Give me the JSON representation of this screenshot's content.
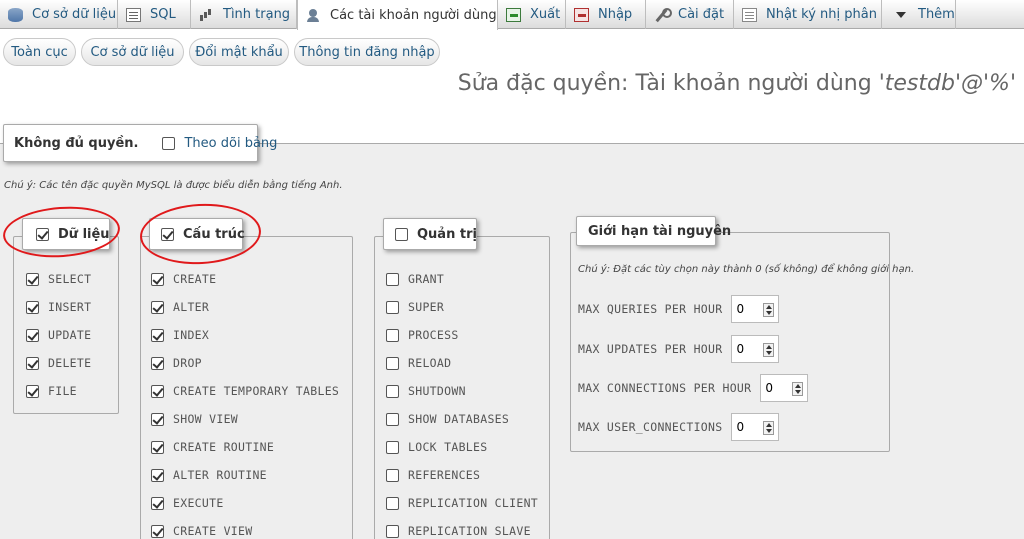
{
  "tabs": [
    {
      "label": "Cơ sở dữ liệu",
      "icon": "database-icon"
    },
    {
      "label": "SQL",
      "icon": "sql-icon"
    },
    {
      "label": "Tình trạng",
      "icon": "status-chart-icon"
    },
    {
      "label": "Các tài khoản người dùng",
      "icon": "users-icon"
    },
    {
      "label": "Xuất",
      "icon": "export-icon"
    },
    {
      "label": "Nhập",
      "icon": "import-icon"
    },
    {
      "label": "Cài đặt",
      "icon": "wrench-icon"
    },
    {
      "label": "Nhật ký nhị phân",
      "icon": "log-icon"
    },
    {
      "label": "Thêm",
      "icon": "caret-down-icon"
    }
  ],
  "subtabs": [
    "Toàn cục",
    "Cơ sở dữ liệu",
    "Đổi mật khẩu",
    "Thông tin đăng nhập"
  ],
  "page_title_prefix": "Sửa đặc quyền: Tài khoản người dùng ",
  "page_title_user": "'testdb'@'%'",
  "global_box": {
    "label": "Không đủ quyền.",
    "track_label": "Theo dõi bảng"
  },
  "note_privileges": "Chú ý: Các tên đặc quyền MySQL là được biểu diễn bằng tiếng Anh.",
  "data_group": {
    "title": "Dữ liệu",
    "checked": true,
    "items": [
      {
        "label": "SELECT",
        "checked": true
      },
      {
        "label": "INSERT",
        "checked": true
      },
      {
        "label": "UPDATE",
        "checked": true
      },
      {
        "label": "DELETE",
        "checked": true
      },
      {
        "label": "FILE",
        "checked": true
      }
    ]
  },
  "structure_group": {
    "title": "Cấu trúc",
    "checked": true,
    "items": [
      {
        "label": "CREATE",
        "checked": true
      },
      {
        "label": "ALTER",
        "checked": true
      },
      {
        "label": "INDEX",
        "checked": true
      },
      {
        "label": "DROP",
        "checked": true
      },
      {
        "label": "CREATE TEMPORARY TABLES",
        "checked": true
      },
      {
        "label": "SHOW VIEW",
        "checked": true
      },
      {
        "label": "CREATE ROUTINE",
        "checked": true
      },
      {
        "label": "ALTER ROUTINE",
        "checked": true
      },
      {
        "label": "EXECUTE",
        "checked": true
      },
      {
        "label": "CREATE VIEW",
        "checked": true
      }
    ]
  },
  "admin_group": {
    "title": "Quản trị",
    "checked": false,
    "items": [
      {
        "label": "GRANT",
        "checked": false
      },
      {
        "label": "SUPER",
        "checked": false
      },
      {
        "label": "PROCESS",
        "checked": false
      },
      {
        "label": "RELOAD",
        "checked": false
      },
      {
        "label": "SHUTDOWN",
        "checked": false
      },
      {
        "label": "SHOW DATABASES",
        "checked": false
      },
      {
        "label": "LOCK TABLES",
        "checked": false
      },
      {
        "label": "REFERENCES",
        "checked": false
      },
      {
        "label": "REPLICATION CLIENT",
        "checked": false
      },
      {
        "label": "REPLICATION SLAVE",
        "checked": false
      }
    ]
  },
  "resource_group": {
    "title": "Giới hạn tài nguyên",
    "note": "Chú ý: Đặt các tùy chọn này thành 0 (số không) để không giới hạn.",
    "items": [
      {
        "label": "MAX QUERIES PER HOUR",
        "value": "0"
      },
      {
        "label": "MAX UPDATES PER HOUR",
        "value": "0"
      },
      {
        "label": "MAX CONNECTIONS PER HOUR",
        "value": "0"
      },
      {
        "label": "MAX USER_CONNECTIONS",
        "value": "0"
      }
    ]
  },
  "colors": {
    "link": "#235a81",
    "annotation": "#e0191b",
    "panel": "#eeeeee"
  }
}
